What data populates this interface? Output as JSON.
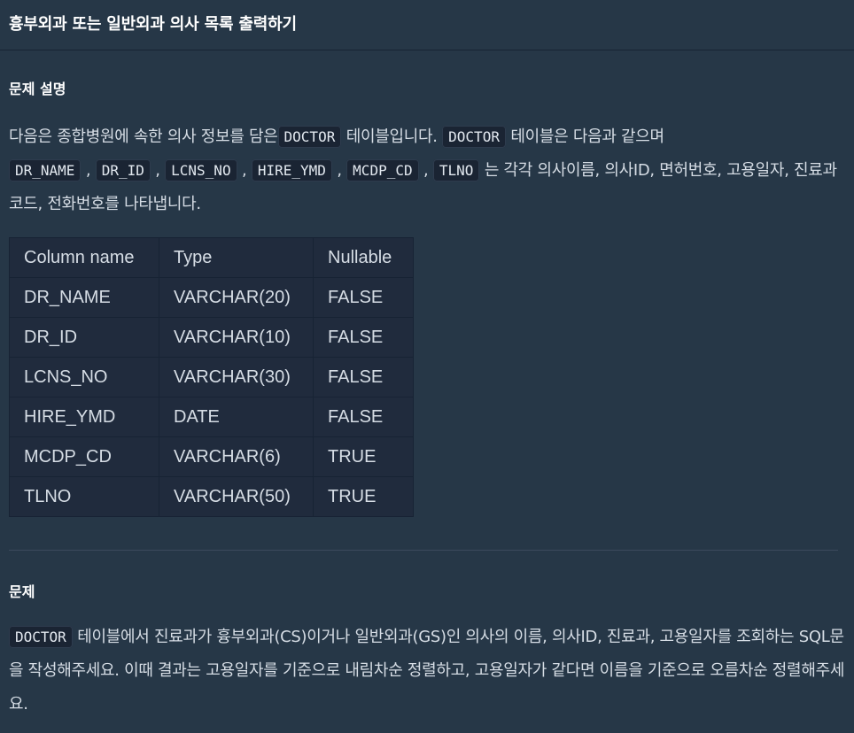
{
  "header": {
    "title": "흉부외과 또는 일반외과 의사 목록 출력하기"
  },
  "description_section": {
    "title": "문제 설명",
    "text_1": "다음은 종합병원에 속한 의사 정보를 담은",
    "code_table": "DOCTOR",
    "text_2": " 테이블입니다. ",
    "text_3": " 테이블은 다음과 같으며",
    "columns_inline": [
      "DR_NAME",
      "DR_ID",
      "LCNS_NO",
      "HIRE_YMD",
      "MCDP_CD",
      "TLNO"
    ],
    "sep": " , ",
    "text_4": " 는 각각 의사이름, 의사ID, 면허번호, 고용일자, 진료과코드, 전화번호를 나타냅니다."
  },
  "schema_table": {
    "headers": [
      "Column name",
      "Type",
      "Nullable"
    ],
    "rows": [
      [
        "DR_NAME",
        "VARCHAR(20)",
        "FALSE"
      ],
      [
        "DR_ID",
        "VARCHAR(10)",
        "FALSE"
      ],
      [
        "LCNS_NO",
        "VARCHAR(30)",
        "FALSE"
      ],
      [
        "HIRE_YMD",
        "DATE",
        "FALSE"
      ],
      [
        "MCDP_CD",
        "VARCHAR(6)",
        "TRUE"
      ],
      [
        "TLNO",
        "VARCHAR(50)",
        "TRUE"
      ]
    ]
  },
  "problem_section": {
    "title": "문제",
    "code_table": "DOCTOR",
    "text": " 테이블에서 진료과가 흉부외과(CS)이거나 일반외과(GS)인 의사의 이름, 의사ID, 진료과, 고용일자를 조회하는 SQL문을 작성해주세요. 이때 결과는 고용일자를 기준으로 내림차순 정렬하고, 고용일자가 같다면 이름을 기준으로 오름차순 정렬해주세요."
  }
}
